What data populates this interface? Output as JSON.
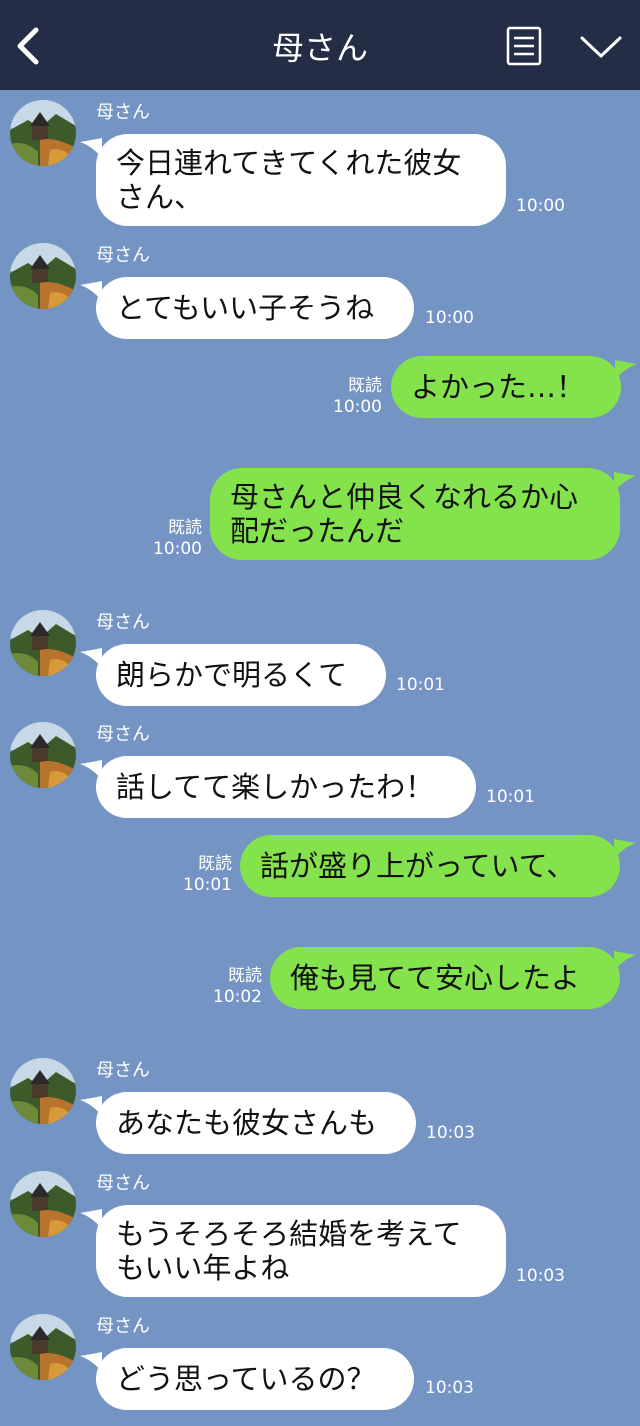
{
  "header": {
    "title": "母さん"
  },
  "messages": [
    {
      "sender": "母さん",
      "text": "今日連れてきてくれた彼女\nさん、",
      "time": "10:00"
    },
    {
      "sender": "母さん",
      "text": "とてもいい子そうね",
      "time": "10:00"
    },
    {
      "read": "既読",
      "text": "よかった…！",
      "time": "10:00"
    },
    {
      "read": "既読",
      "text": "母さんと仲良くなれるか心\n配だったんだ",
      "time": "10:00"
    },
    {
      "sender": "母さん",
      "text": "朗らかで明るくて",
      "time": "10:01"
    },
    {
      "sender": "母さん",
      "text": "話してて楽しかったわ！",
      "time": "10:01"
    },
    {
      "read": "既読",
      "text": "話が盛り上がっていて、",
      "time": "10:01"
    },
    {
      "read": "既読",
      "text": "俺も見てて安心したよ",
      "time": "10:02"
    },
    {
      "sender": "母さん",
      "text": "あなたも彼女さんも",
      "time": "10:03"
    },
    {
      "sender": "母さん",
      "text": "もうそろそろ結婚を考えて\nもいい年よね",
      "time": "10:03"
    },
    {
      "sender": "母さん",
      "text": "どう思っているの？",
      "time": "10:03"
    }
  ],
  "colors": {
    "header_bg": "#232e46",
    "chat_bg": "#7494c4",
    "incoming_bubble": "#ffffff",
    "outgoing_bubble": "#84e34c"
  }
}
